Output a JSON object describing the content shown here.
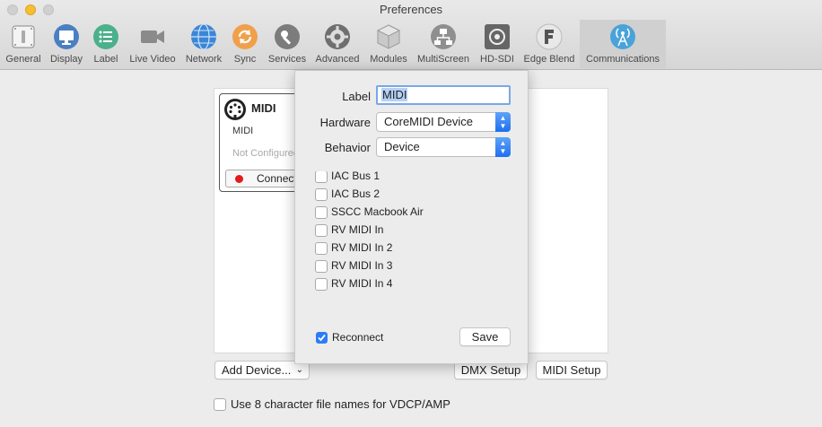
{
  "window": {
    "title": "Preferences"
  },
  "toolbar": {
    "items": [
      {
        "label": "General",
        "icon": "general-icon"
      },
      {
        "label": "Display",
        "icon": "display-icon"
      },
      {
        "label": "Label",
        "icon": "label-icon"
      },
      {
        "label": "Live Video",
        "icon": "video-camera-icon"
      },
      {
        "label": "Network",
        "icon": "globe-icon"
      },
      {
        "label": "Sync",
        "icon": "sync-icon"
      },
      {
        "label": "Services",
        "icon": "wrench-icon"
      },
      {
        "label": "Advanced",
        "icon": "gear-icon"
      },
      {
        "label": "Modules",
        "icon": "box-icon"
      },
      {
        "label": "MultiScreen",
        "icon": "network-diagram-icon"
      },
      {
        "label": "HD-SDI",
        "icon": "hdsdi-icon"
      },
      {
        "label": "Edge Blend",
        "icon": "edge-blend-icon"
      },
      {
        "label": "Communications",
        "icon": "antenna-icon"
      }
    ],
    "active": "Communications"
  },
  "device": {
    "title": "MIDI",
    "subtitle": "MIDI",
    "status": "Not Configured",
    "connect_label": "Connect"
  },
  "popover": {
    "label_caption": "Label",
    "label_value": "MIDI",
    "hardware_caption": "Hardware",
    "hardware_value": "CoreMIDI Device",
    "behavior_caption": "Behavior",
    "behavior_value": "Device",
    "ports": [
      {
        "label": "IAC Bus 1",
        "checked": false
      },
      {
        "label": "IAC Bus 2",
        "checked": false
      },
      {
        "label": "SSCC Macbook Air",
        "checked": false
      },
      {
        "label": "RV MIDI In",
        "checked": false
      },
      {
        "label": "RV MIDI In 2",
        "checked": false
      },
      {
        "label": "RV MIDI In 3",
        "checked": false
      },
      {
        "label": "RV MIDI In 4",
        "checked": false
      }
    ],
    "reconnect_label": "Reconnect",
    "reconnect_checked": true,
    "save_label": "Save"
  },
  "footer": {
    "add_device_label": "Add Device...",
    "dmx_setup_label": "DMX Setup",
    "midi_setup_label": "MIDI Setup",
    "file_names_label": "Use 8 character file names for VDCP/AMP",
    "file_names_checked": false
  },
  "colors": {
    "accent": "#1e6ff0",
    "selection": "#b6d0f6",
    "status_red": "#e21b1b",
    "active_tab": "#d0d0d0"
  }
}
